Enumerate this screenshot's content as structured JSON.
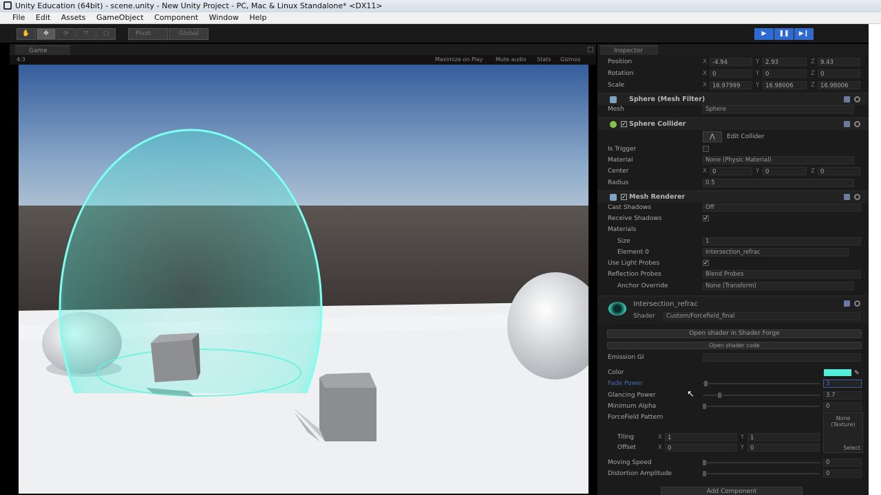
{
  "window": {
    "title": "Unity Education (64bit) - scene.unity - New Unity Project - PC, Mac & Linux Standalone* <DX11>"
  },
  "menu": [
    "File",
    "Edit",
    "Assets",
    "GameObject",
    "Component",
    "Window",
    "Help"
  ],
  "toolbar": {
    "pivot": "Pivot",
    "global": "Global"
  },
  "game": {
    "tab": "Game",
    "aspect": "4:3",
    "controls": {
      "maximize": "Maximize on Play",
      "mute": "Mute audio",
      "stats": "Stats",
      "gizmos": "Gizmos"
    }
  },
  "inspector": {
    "tab": "Inspector",
    "transform": {
      "position": {
        "label": "Position",
        "x": "-4.94",
        "y": "2.93",
        "z": "9.43"
      },
      "rotation": {
        "label": "Rotation",
        "x": "0",
        "y": "0",
        "z": "0"
      },
      "scale": {
        "label": "Scale",
        "x": "16.97999",
        "y": "16.98006",
        "z": "16.98006"
      }
    },
    "mesh_filter": {
      "title": "Sphere (Mesh Filter)",
      "mesh_label": "Mesh",
      "mesh_value": "Sphere"
    },
    "sphere_collider": {
      "title": "Sphere Collider",
      "edit_collider": "Edit Collider",
      "is_trigger": "Is Trigger",
      "material_label": "Material",
      "material_value": "None (Physic Material)",
      "center_label": "Center",
      "center": {
        "x": "0",
        "y": "0",
        "z": "0"
      },
      "radius_label": "Radius",
      "radius_value": "0.5"
    },
    "mesh_renderer": {
      "title": "Mesh Renderer",
      "cast_shadows": "Cast Shadows",
      "cast_shadows_value": "Off",
      "receive_shadows": "Receive Shadows",
      "materials": "Materials",
      "size_label": "Size",
      "size_value": "1",
      "element0_label": "Element 0",
      "element0_value": "Intersection_refrac",
      "light_probes": "Use Light Probes",
      "reflection_probes": "Reflection Probes",
      "reflection_probes_value": "Blend Probes",
      "anchor_override": "Anchor Override",
      "anchor_override_value": "None (Transform)"
    },
    "material": {
      "name": "Intersection_refrac",
      "shader_label": "Shader",
      "shader_value": "Custom/Forcefield_final",
      "open_shader_forge": "Open shader in Shader Forge",
      "open_shader_code": "Open shader code",
      "emission_gi": "Emission GI",
      "color_label": "Color",
      "color_hex": "#4ef0dc",
      "fade_power_label": "Fade Power",
      "fade_power_value": "3",
      "glancing_power_label": "Glancing Power",
      "glancing_power_value": "3.7",
      "minimum_alpha_label": "Minimum Alpha",
      "minimum_alpha_value": "0",
      "pattern_label": "ForceField Pattern",
      "texture_none": "None",
      "texture_type": "(Texture)",
      "texture_select": "Select",
      "tiling_label": "Tiling",
      "tiling": {
        "x": "1",
        "y": "1"
      },
      "offset_label": "Offset",
      "offset": {
        "x": "0",
        "y": "0"
      },
      "moving_speed_label": "Moving Speed",
      "moving_speed_value": "0",
      "distortion_label": "Distortion Amplitude",
      "distortion_value": "0"
    },
    "add_component": "Add Component"
  },
  "colors": {
    "accent_blue": "#2d6bd3",
    "forcefield": "#4ef0dc"
  }
}
